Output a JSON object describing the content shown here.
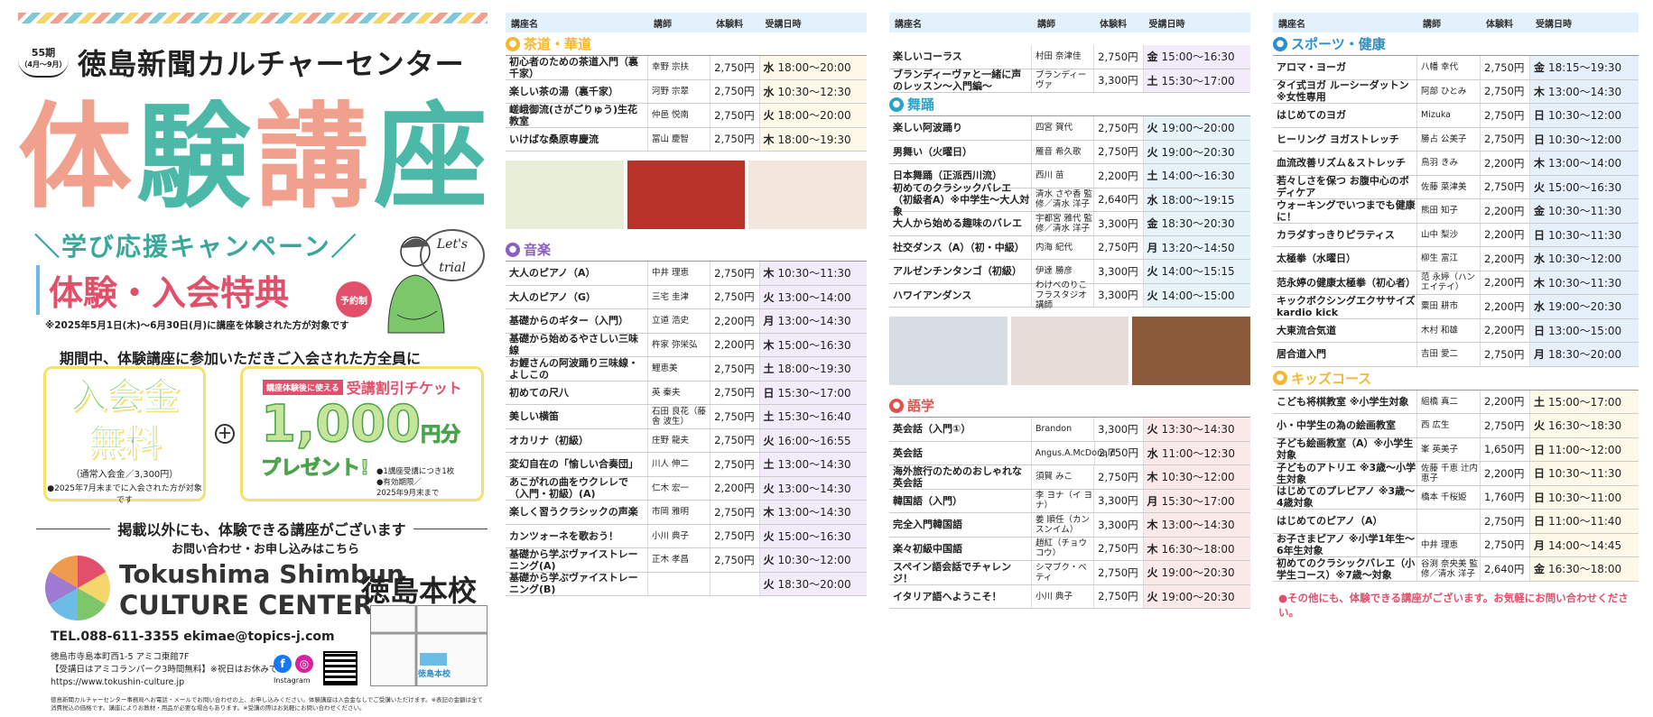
{
  "left": {
    "term": "55期",
    "term_sub": "（4月〜9月）",
    "center_name": "徳島新聞カルチャーセンター",
    "big_title": [
      "体",
      "験",
      "講",
      "座"
    ],
    "campaign": "＼学び応援キャンペーン／",
    "tokuten": "体験・入会特典",
    "yoyaku": "予約制",
    "lets_trial": "Let's trial",
    "note1": "※2025年5月1日(木)〜6月30日(月)に講座を体験された方が対象です",
    "kikan": "期間中、体験講座に参加いただきご入会された方全員に",
    "box1_title1": "入会金",
    "box1_title2": "無料",
    "box1_sub1": "（通常入会金／3,300円）",
    "box1_sub2": "●2025年7月末までに入会された方が対象です",
    "plus": "＋",
    "ticket_tag": "講座体験後に使える",
    "ticket_name": "受講割引チケット",
    "ticket_amount": "1,000",
    "ticket_yen": "円分",
    "ticket_present": "プレゼント!",
    "ticket_note1": "●1講座受講につき1枚",
    "ticket_note2": "●有効期限／",
    "ticket_note3": "2025年9月末まで",
    "other": "掲載以外にも、体験できる講座がございます",
    "toiawase": "お問い合わせ・お申し込みはこちら",
    "brand1": "Tokushima Shimbun",
    "brand2": "CULTURE CENTER",
    "honko": "徳島本校",
    "tel": "TEL.088-611-3355  ekimae@topics-j.com",
    "addr1": "徳島市寺島本町西1-5 アミコ東館7F",
    "addr2": "【受講日はアミコランパーク3時間無料】※祝日はお休みです",
    "addr3": "https://www.tokushin-culture.jp",
    "instagram": "Instagram",
    "map_label": "徳島本校",
    "fine": "徳島新聞カルチャーセンター事務局へお電話・メールでお問い合わせの上、お申し込みください。体験講座は入会金なしでご受講いただけます。※表記の金額は全て消費税込の価格です。講座によりお教材・用品が必要な場合もあります。※受講の際はお気軽にお問い合わせください。"
  },
  "head": {
    "name": "講座名",
    "teacher": "講師",
    "fee": "体験料",
    "date": "受講日時"
  },
  "col1": {
    "cat1": {
      "icon": "tea-icon",
      "name": "茶道・華道",
      "rows": [
        {
          "name": "初心者のための茶道入門（裏千家）",
          "teacher": "幸野 宗扶",
          "fee": "2,750円",
          "day": "水",
          "time": "18:00〜20:00"
        },
        {
          "name": "楽しい茶の湯（裏千家）",
          "teacher": "河野 宗翠",
          "fee": "2,750円",
          "day": "水",
          "time": "10:30〜12:30"
        },
        {
          "name": "嵯峨御流(さがごりゅう)生花教室",
          "teacher": "仲邑 悦南",
          "fee": "2,750円",
          "day": "火",
          "time": "18:00〜20:00"
        },
        {
          "name": "いけばな桑原専慶流",
          "teacher": "冨山 慶智",
          "fee": "2,750円",
          "day": "木",
          "time": "18:00〜19:30"
        }
      ]
    },
    "cat2": {
      "icon": "music-icon",
      "name": "音楽",
      "rows": [
        {
          "name": "大人のピアノ（A）",
          "teacher": "中井 理恵",
          "fee": "2,750円",
          "day": "木",
          "time": "10:30〜11:30"
        },
        {
          "name": "大人のピアノ（G）",
          "teacher": "三宅 圭津",
          "fee": "2,750円",
          "day": "火",
          "time": "13:00〜14:00"
        },
        {
          "name": "基礎からのギター（入門）",
          "teacher": "立道 浩史",
          "fee": "2,200円",
          "day": "月",
          "time": "13:00〜14:30"
        },
        {
          "name": "基礎から始めるやさしい三味線",
          "teacher": "杵家 弥栄弘",
          "fee": "2,200円",
          "day": "木",
          "time": "15:00〜16:30"
        },
        {
          "name": "お鯉さんの阿波踊り三味線・よしこの",
          "teacher": "鯉恵美",
          "fee": "2,750円",
          "day": "土",
          "time": "18:00〜19:30"
        },
        {
          "name": "初めての尺八",
          "teacher": "英 秦夫",
          "fee": "2,750円",
          "day": "日",
          "time": "15:30〜17:00"
        },
        {
          "name": "美しい横笛",
          "teacher": "石田 良花（藤舎 波生）",
          "fee": "2,750円",
          "day": "土",
          "time": "15:30〜16:40"
        },
        {
          "name": "オカリナ（初級）",
          "teacher": "庄野 龍夫",
          "fee": "2,750円",
          "day": "火",
          "time": "16:00〜16:55"
        },
        {
          "name": "変幻自在の「愉しい合奏団」",
          "teacher": "川人 伸二",
          "fee": "2,750円",
          "day": "土",
          "time": "13:00〜14:30"
        },
        {
          "name": "あこがれの曲をウクレレで（入門・初級）(A)",
          "teacher": "仁木 宏一",
          "fee": "2,200円",
          "day": "火",
          "time": "13:00〜14:30"
        },
        {
          "name": "楽しく習うクラシックの声楽",
          "teacher": "市岡 雅明",
          "fee": "2,750円",
          "day": "木",
          "time": "13:00〜14:30"
        },
        {
          "name": "カンツォーネを歌おう！",
          "teacher": "小川 典子",
          "fee": "2,750円",
          "day": "火",
          "time": "15:00〜16:30"
        },
        {
          "name": "基礎から学ぶヴァイストレーニング(A)",
          "teacher": "正木 孝昌",
          "fee": "2,750円",
          "day": "火",
          "time": "10:30〜12:00"
        },
        {
          "name": "基礎から学ぶヴァイストレーニング(B)",
          "teacher": "",
          "fee": "",
          "day": "火",
          "time": "18:30〜20:00"
        }
      ]
    }
  },
  "col2": {
    "cat0": {
      "rows": [
        {
          "name": "楽しいコーラス",
          "teacher": "村田 奈津佳",
          "fee": "2,750円",
          "day": "金",
          "time": "15:00〜16:30"
        },
        {
          "name": "ブランディーヴァと一緒に声のレッスン〜入門編〜",
          "teacher": "ブランディーヴァ",
          "fee": "3,300円",
          "day": "土",
          "time": "15:30〜17:00"
        }
      ]
    },
    "cat1": {
      "icon": "dance-icon",
      "name": "舞踊",
      "rows": [
        {
          "name": "楽しい阿波踊り",
          "teacher": "四宮 賀代",
          "fee": "2,750円",
          "day": "火",
          "time": "19:00〜20:00"
        },
        {
          "name": "男舞い（火曜日）",
          "teacher": "雁音 希久歌",
          "fee": "2,750円",
          "day": "火",
          "time": "19:00〜20:30"
        },
        {
          "name": "日本舞踊（正派西川流）",
          "teacher": "西川 苗",
          "fee": "2,200円",
          "day": "土",
          "time": "14:00〜16:30"
        },
        {
          "name": "初めてのクラシックバレエ（初級者A）※中学生〜大人対象",
          "teacher": "清水 さや香 監修／清水 洋子",
          "fee": "2,640円",
          "day": "水",
          "time": "18:00〜19:15"
        },
        {
          "name": "大人から始める趣味のバレエ",
          "teacher": "宇都宮 雅代 監修／清水 洋子",
          "fee": "3,300円",
          "day": "金",
          "time": "18:30〜20:30"
        },
        {
          "name": "社交ダンス（A）（初・中級）",
          "teacher": "内海 紀代",
          "fee": "2,750円",
          "day": "月",
          "time": "13:20〜14:50"
        },
        {
          "name": "アルゼンチンタンゴ（初級）",
          "teacher": "伊達 勝彦",
          "fee": "3,300円",
          "day": "火",
          "time": "14:00〜15:15"
        },
        {
          "name": "ハワイアンダンス",
          "teacher": "わけべのりこ フラスタジオ講師",
          "fee": "3,300円",
          "day": "火",
          "time": "14:00〜15:00"
        }
      ]
    },
    "cat2": {
      "icon": "language-icon",
      "name": "語学",
      "rows": [
        {
          "name": "英会話（入門①）",
          "teacher": "Brandon",
          "fee": "3,300円",
          "day": "火",
          "time": "13:30〜14:30"
        },
        {
          "name": "英会話",
          "teacher": "Angus.A.McDonald",
          "fee": "2,750円",
          "day": "水",
          "time": "11:00〜12:30"
        },
        {
          "name": "海外旅行のためのおしゃれな英会話",
          "teacher": "須賀 みこ",
          "fee": "2,750円",
          "day": "木",
          "time": "10:30〜12:00"
        },
        {
          "name": "韓国語（入門）",
          "teacher": "李 ヨナ（イ ヨナ）",
          "fee": "3,300円",
          "day": "月",
          "time": "15:30〜17:00"
        },
        {
          "name": "完全入門韓国語",
          "teacher": "姜 順任（カン スンイム）",
          "fee": "3,300円",
          "day": "木",
          "time": "13:00〜14:30"
        },
        {
          "name": "楽々初級中国語",
          "teacher": "趙紅（チョウ コウ）",
          "fee": "2,750円",
          "day": "木",
          "time": "16:30〜18:00"
        },
        {
          "name": "スペイン語会話でチャレンジ！",
          "teacher": "シマブク・ベティ",
          "fee": "2,750円",
          "day": "火",
          "time": "19:00〜20:30"
        },
        {
          "name": "イタリア語へようこそ！",
          "teacher": "小川 典子",
          "fee": "2,750円",
          "day": "火",
          "time": "19:00〜20:30"
        }
      ]
    }
  },
  "col3": {
    "cat1": {
      "icon": "sports-icon",
      "name": "スポーツ・健康",
      "rows": [
        {
          "name": "アロマ・ヨーガ",
          "teacher": "八幡 幸代",
          "fee": "2,750円",
          "day": "金",
          "time": "18:15〜19:30"
        },
        {
          "name": "タイ式ヨガ ルーシーダットン ※女性専用",
          "teacher": "阿部 ひとみ",
          "fee": "2,750円",
          "day": "木",
          "time": "13:00〜14:30"
        },
        {
          "name": "はじめてのヨガ",
          "teacher": "Mizuka",
          "fee": "2,750円",
          "day": "日",
          "time": "10:30〜12:00"
        },
        {
          "name": "ヒーリング ヨガストレッチ",
          "teacher": "勝占 公美子",
          "fee": "2,750円",
          "day": "日",
          "time": "10:30〜12:00"
        },
        {
          "name": "血流改善リズム＆ストレッチ",
          "teacher": "鳥羽 きみ",
          "fee": "2,200円",
          "day": "木",
          "time": "13:00〜14:00"
        },
        {
          "name": "若々しさを保つ お腹中心のボディケア",
          "teacher": "佐藤 菜津美",
          "fee": "2,750円",
          "day": "火",
          "time": "15:00〜16:30"
        },
        {
          "name": "ウォーキングでいつまでも健康に！",
          "teacher": "熊田 知子",
          "fee": "2,200円",
          "day": "金",
          "time": "10:30〜11:30"
        },
        {
          "name": "カラダすっきりピラティス",
          "teacher": "山中 梨沙",
          "fee": "2,200円",
          "day": "日",
          "time": "10:30〜11:30"
        },
        {
          "name": "太極拳（水曜日）",
          "teacher": "柳生 富江",
          "fee": "2,200円",
          "day": "水",
          "time": "10:30〜12:00"
        },
        {
          "name": "范永婷の健康太極拳（初心者）",
          "teacher": "范 永婷（ハン エイテイ）",
          "fee": "2,200円",
          "day": "木",
          "time": "10:30〜11:30"
        },
        {
          "name": "キックボクシングエクササイズ kardio kick",
          "teacher": "粟田 耕市",
          "fee": "2,200円",
          "day": "水",
          "time": "19:00〜20:30"
        },
        {
          "name": "大東流合気道",
          "teacher": "木村 和雄",
          "fee": "2,200円",
          "day": "日",
          "time": "13:00〜15:00"
        },
        {
          "name": "居合道入門",
          "teacher": "吉田 愛二",
          "fee": "2,750円",
          "day": "月",
          "time": "18:30〜20:00"
        }
      ]
    },
    "cat2": {
      "icon": "kids-icon",
      "name": "キッズコース",
      "rows": [
        {
          "name": "こども将棋教室 ※小学生対象",
          "teacher": "組橋 真二",
          "fee": "2,200円",
          "day": "土",
          "time": "15:00〜17:00"
        },
        {
          "name": "小・中学生の為の絵画教室",
          "teacher": "西 広生",
          "fee": "2,750円",
          "day": "火",
          "time": "16:30〜18:30"
        },
        {
          "name": "子ども絵画教室（A）※小学生対象",
          "teacher": "峯 英美子",
          "fee": "1,650円",
          "day": "日",
          "time": "11:00〜12:00"
        },
        {
          "name": "子どものアトリエ ※3歳〜小学生対象",
          "teacher": "佐藤 千恵 辻内 恵子",
          "fee": "2,200円",
          "day": "日",
          "time": "10:30〜11:30"
        },
        {
          "name": "はじめてのプレピアノ ※3歳〜4歳対象",
          "teacher": "橋本 千桜姫",
          "fee": "1,760円",
          "day": "日",
          "time": "10:30〜11:00"
        },
        {
          "name": "はじめてのピアノ（A）",
          "teacher": "",
          "fee": "2,750円",
          "day": "日",
          "time": "11:00〜11:40"
        },
        {
          "name": "お子さまピアノ ※小学1年生〜6年生対象",
          "teacher": "中井 理恵",
          "fee": "2,750円",
          "day": "月",
          "time": "14:00〜14:45"
        },
        {
          "name": "初めてのクラシックバレエ（小学生コース）※7歳〜対象",
          "teacher": "谷渕 奈央美 監修／清水 洋子",
          "fee": "2,640円",
          "day": "金",
          "time": "16:30〜18:00"
        }
      ]
    },
    "footnote": "●その他にも、体験できる講座がございます。お気軽にお問い合わせください。"
  },
  "colors": {
    "pink": "#e24f6a",
    "green": "#7cc76a",
    "blue": "#6bbde5",
    "yellow": "#f5d66a",
    "tea": "#f5b731",
    "music": "#8a5fc0",
    "dance": "#2aa3c9",
    "lang": "#e24f4f",
    "sports": "#2a8fd0",
    "kids": "#f5b731"
  }
}
